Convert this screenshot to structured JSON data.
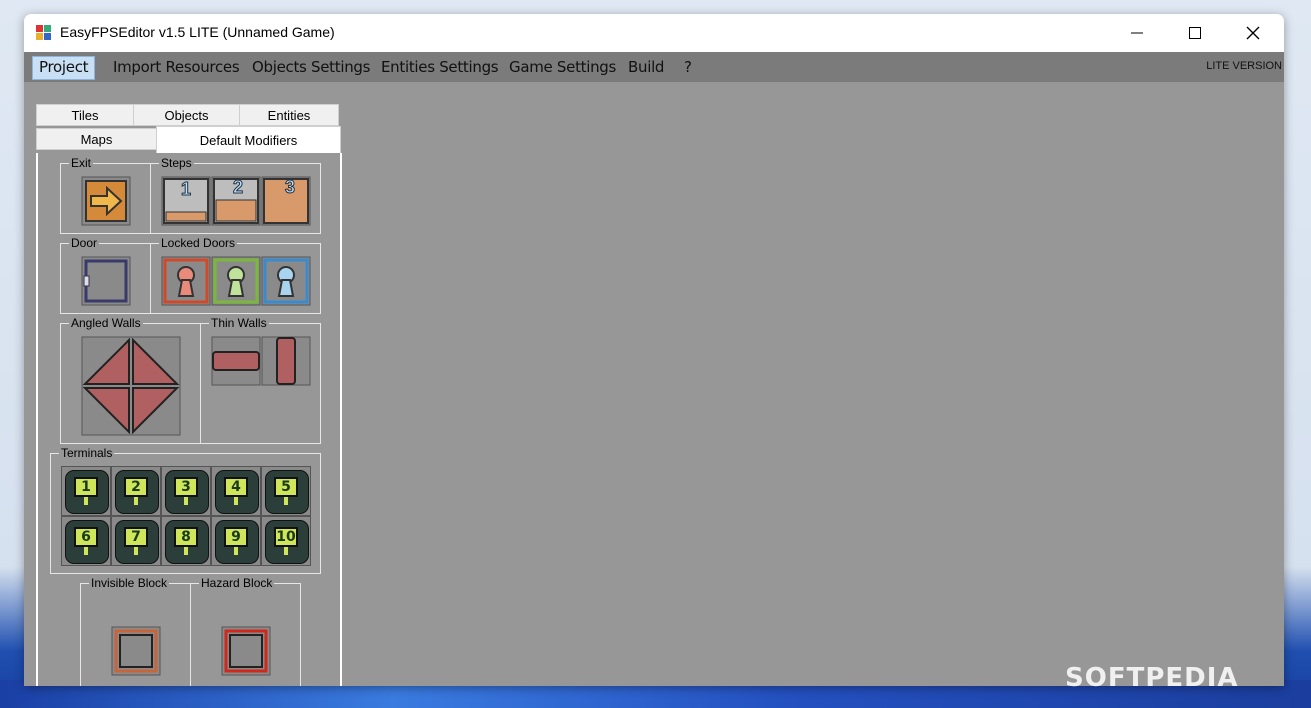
{
  "window": {
    "title": "EasyFPSEditor v1.5 LITE (Unnamed Game)"
  },
  "menu": {
    "items": [
      "Project",
      "Import Resources",
      "Objects Settings",
      "Entities Settings",
      "Game Settings",
      "Build",
      "?"
    ],
    "right_label": "LITE VERSION"
  },
  "tabs": {
    "row1": [
      "Tiles",
      "Objects",
      "Entities"
    ],
    "row2": [
      "Maps",
      "Default Modifiers"
    ]
  },
  "groups": {
    "exit": "Exit",
    "steps": "Steps",
    "door": "Door",
    "locked_doors": "Locked Doors",
    "angled_walls": "Angled Walls",
    "thin_walls": "Thin Walls",
    "terminals": "Terminals",
    "invisible_block": "Invisible Block",
    "hazard_block": "Hazard Block"
  },
  "steps": [
    "1",
    "2",
    "3"
  ],
  "terminals": [
    "1",
    "2",
    "3",
    "4",
    "5",
    "6",
    "7",
    "8",
    "9",
    "10"
  ],
  "watermark": "SOFTPEDIA",
  "colors": {
    "menu_bg": "#7b7b7b",
    "panel_bg": "#979797",
    "active_menu": "#c9dff4",
    "wall": "#b06060",
    "step": "#d89a6a",
    "terminal": "#2c3e3a"
  }
}
